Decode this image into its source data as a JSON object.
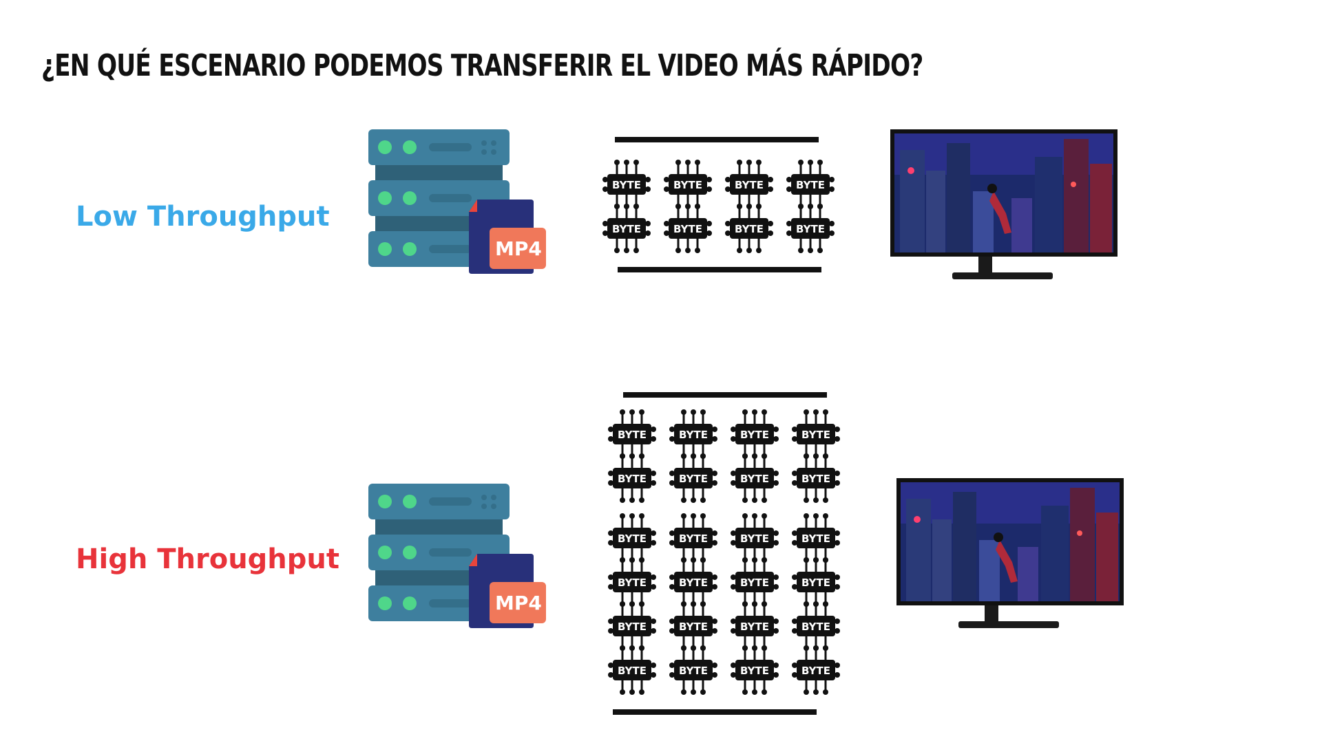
{
  "title": "¿EN QUÉ ESCENARIO PODEMOS TRANSFERIR EL VIDEO MÁS RÁPIDO?",
  "scenarios": [
    {
      "label": "Low Throughput",
      "label_color": "#3aa9e8",
      "file_badge": "MP4",
      "chip_label": "BYTE",
      "chip_count": 8
    },
    {
      "label": "High Throughput",
      "label_color": "#e8333a",
      "file_badge": "MP4",
      "chip_label": "BYTE",
      "chip_count": 24
    }
  ],
  "colors": {
    "server_body": "#3e7f9e",
    "server_dark": "#2f6178",
    "server_light": "#4fd68a",
    "file_dark": "#28307a",
    "file_accent": "#f0785a",
    "file_fold": "#e8453c",
    "chip": "#111111",
    "pipe": "#111111"
  },
  "icons": {
    "server": "server-stack-icon",
    "file": "mp4-file-icon",
    "chip": "byte-chip-icon",
    "monitor": "monitor-icon"
  }
}
